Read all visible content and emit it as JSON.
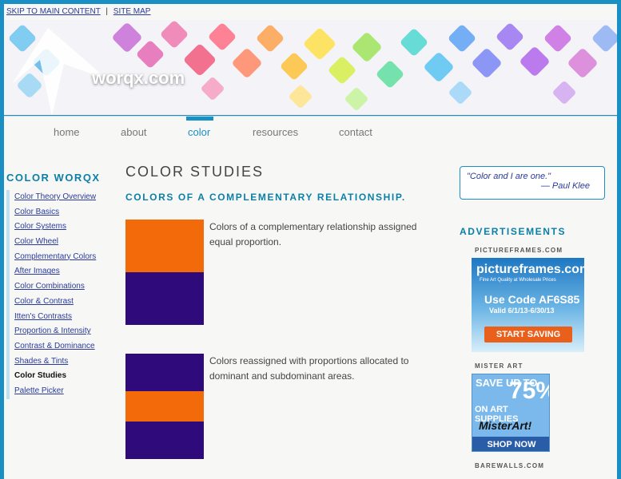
{
  "skip_links": {
    "main": "SKIP TO MAIN CONTENT",
    "sitemap": "SITE MAP",
    "separator": "|"
  },
  "banner": {
    "logo": "worqx.com"
  },
  "nav": [
    {
      "label": "home"
    },
    {
      "label": "about"
    },
    {
      "label": "color",
      "active": true
    },
    {
      "label": "resources"
    },
    {
      "label": "contact"
    }
  ],
  "sidebar": {
    "title": "COLOR WORQX",
    "items": [
      "Color Theory Overview",
      "Color Basics",
      "Color Systems",
      "Color Wheel",
      "Complementary Colors",
      "After Images",
      "Color Combinations",
      "Color & Contrast",
      "Itten's Contrasts",
      "Proportion & Intensity",
      "Contrast & Dominance",
      "Shades & Tints",
      "Color Studies",
      "Palette Picker"
    ],
    "current": "Color Studies"
  },
  "main": {
    "title": "COLOR STUDIES",
    "subtitle": "COLORS OF A COMPLEMENTARY RELATIONSHIP.",
    "studies": [
      {
        "text": "Colors of a complementary relationship assigned equal proportion."
      },
      {
        "text": "Colors reassigned with proportions allocated to dominant and subdominant areas."
      }
    ],
    "colors": {
      "orange": "#f26a0a",
      "purple": "#2e0a7a"
    }
  },
  "right": {
    "quote": "\"Color and I are one.\"",
    "quote_author": "— Paul Klee",
    "ads_title": "ADVERTISEMENTS",
    "ads": [
      {
        "label": "PICTUREFRAMES.COM",
        "brand": "pictureframes.com",
        "tagline": "Fine Art Quality at Wholesale Prices",
        "code": "Use Code AF6S85",
        "valid": "Valid 6/1/13-6/30/13",
        "button": "START SAVING"
      },
      {
        "label": "MISTER ART",
        "line1": "SAVE UP TO",
        "percent": "75%",
        "line2": "ON ART SUPPLIES",
        "brand": "MisterArt!",
        "button": "SHOP NOW"
      },
      {
        "label": "BAREWALLS.COM"
      }
    ]
  }
}
